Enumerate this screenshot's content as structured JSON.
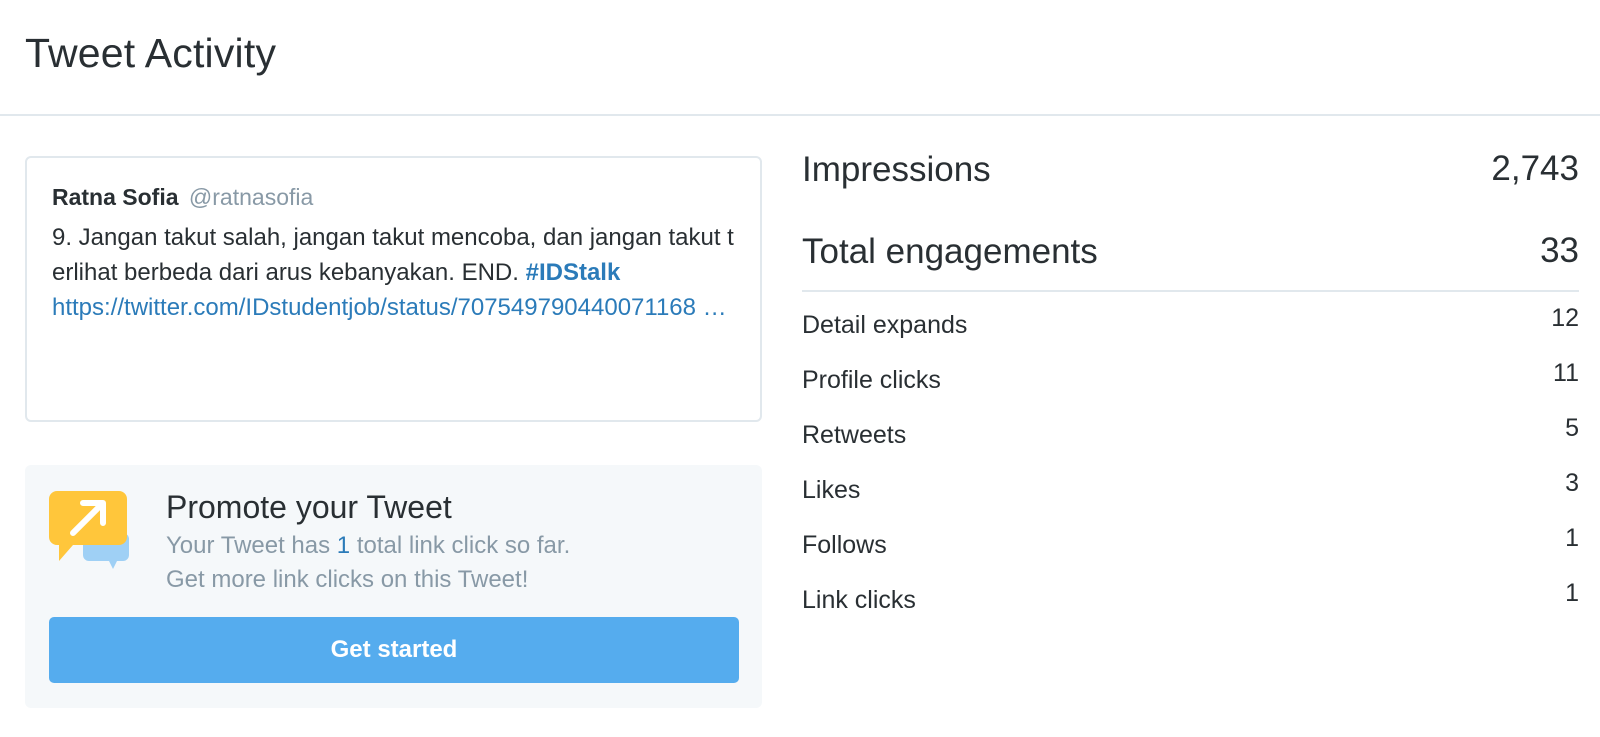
{
  "page": {
    "title": "Tweet Activity"
  },
  "tweet": {
    "author_name": "Ratna Sofia",
    "author_handle": "@ratnasofia",
    "text": "9. Jangan takut salah, jangan takut mencoba, dan jangan takut terlihat berbeda dari arus kebanyakan. END. ",
    "hashtag": "#IDStalk",
    "link": "https://twitter.com/IDstudentjob/status/707549790440071168 …"
  },
  "promote": {
    "icon": "promote-speech-bubble-icon",
    "title": "Promote your Tweet",
    "line1_prefix": "Your Tweet has ",
    "link_click_count": "1",
    "line1_suffix": " total link click so far.",
    "line2": "Get more link clicks on this Tweet!",
    "button_label": "Get started"
  },
  "stats": {
    "impressions": {
      "label": "Impressions",
      "value": "2,743"
    },
    "engagements": {
      "label": "Total engagements",
      "value": "33"
    },
    "breakdown": [
      {
        "label": "Detail expands",
        "value": "12"
      },
      {
        "label": "Profile clicks",
        "value": "11"
      },
      {
        "label": "Retweets",
        "value": "5"
      },
      {
        "label": "Likes",
        "value": "3"
      },
      {
        "label": "Follows",
        "value": "1"
      },
      {
        "label": "Link clicks",
        "value": "1"
      }
    ]
  },
  "colors": {
    "accent": "#55acee",
    "link": "#2b7bb9",
    "muted": "#8899a6",
    "promote_icon": "#ffc63b"
  }
}
